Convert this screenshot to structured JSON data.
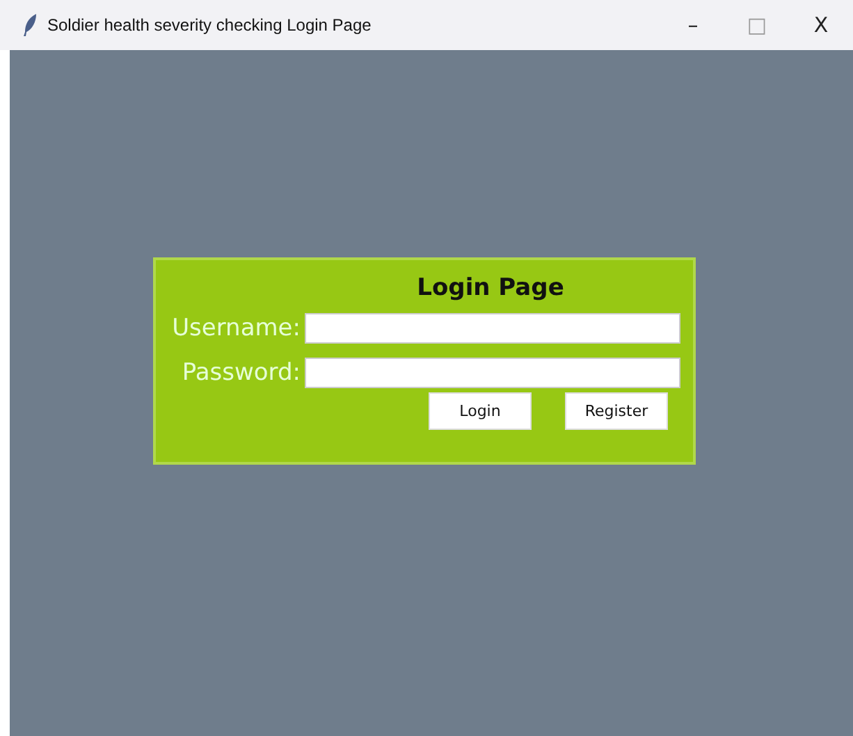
{
  "window": {
    "title": "Soldier health severity checking Login Page",
    "controls": [
      {
        "label": "–",
        "disabled": false
      },
      {
        "label": "□",
        "disabled": true
      },
      {
        "label": "X",
        "disabled": false
      }
    ]
  },
  "login": {
    "heading": "Login Page",
    "fields": [
      {
        "label": "Username:"
      },
      {
        "label": "Password:"
      }
    ],
    "buttons": [
      "Login",
      "Register"
    ]
  }
}
